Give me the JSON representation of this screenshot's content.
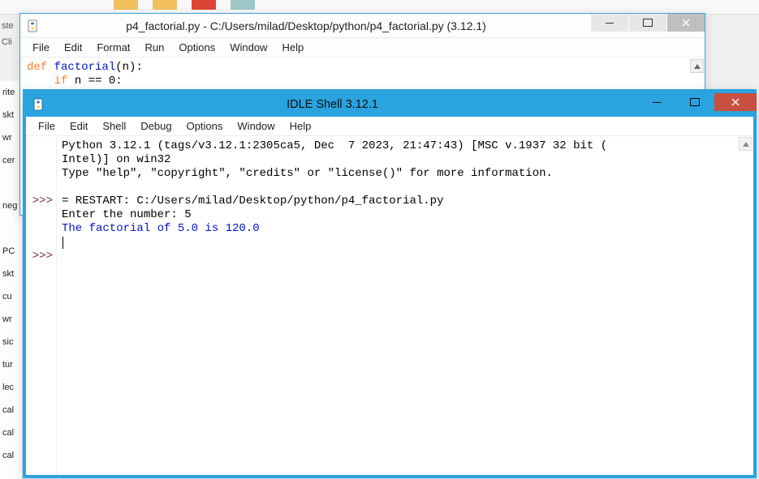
{
  "editor": {
    "title": "p4_factorial.py - C:/Users/milad/Desktop/python/p4_factorial.py (3.12.1)",
    "menu": [
      "File",
      "Edit",
      "Format",
      "Run",
      "Options",
      "Window",
      "Help"
    ],
    "code": {
      "kw1": "def",
      "fn": "factorial",
      "rest1": "(n):",
      "line2a": "    ",
      "kw2": "if",
      "line2b": " n == 0:"
    }
  },
  "shell": {
    "title": "IDLE Shell 3.12.1",
    "menu": [
      "File",
      "Edit",
      "Shell",
      "Debug",
      "Options",
      "Window",
      "Help"
    ],
    "prompts": {
      "p1": ">>>",
      "p2": ">>>"
    },
    "lines": {
      "l1": "Python 3.12.1 (tags/v3.12.1:2305ca5, Dec  7 2023, 21:47:43) [MSC v.1937 32 bit (",
      "l2": "Intel)] on win32",
      "l3": "Type \"help\", \"copyright\", \"credits\" or \"license()\" for more information.",
      "l4": "",
      "l5": "= RESTART: C:/Users/milad/Desktop/python/p4_factorial.py",
      "l6": "Enter the number: ",
      "l6_input": "5",
      "l7": "The factorial of 5.0 is 120.0"
    }
  },
  "bg": {
    "labels": {
      "a": "ste",
      "b": "Cli"
    },
    "side": [
      "rite",
      "skt",
      "wr",
      "cer",
      "",
      "neg",
      "",
      "PC",
      "skt",
      "cu",
      "wr",
      "sic",
      "tur",
      "lec",
      "cal",
      "cal",
      "cal"
    ]
  }
}
